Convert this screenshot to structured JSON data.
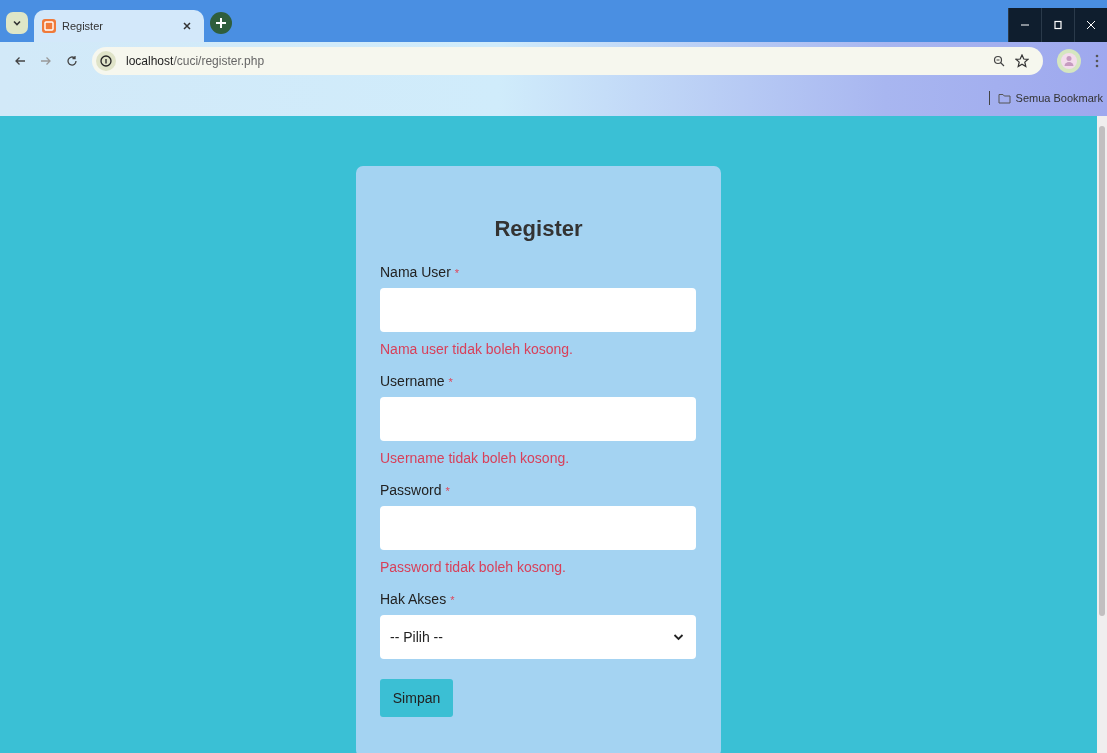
{
  "browser": {
    "tab_title": "Register",
    "url_host": "localhost",
    "url_path": "/cuci/register.php",
    "bookmarks_label": "Semua Bookmark"
  },
  "form": {
    "title": "Register",
    "required_mark": "*",
    "fields": [
      {
        "kind": "text",
        "label": "Nama User",
        "required": true,
        "error": "Nama user tidak boleh kosong."
      },
      {
        "kind": "text",
        "label": "Username",
        "required": true,
        "error": "Username tidak boleh kosong."
      },
      {
        "kind": "password",
        "label": "Password",
        "required": true,
        "error": "Password tidak boleh kosong."
      },
      {
        "kind": "select",
        "label": "Hak Akses",
        "required": true,
        "value": "-- Pilih --"
      }
    ],
    "submit_label": "Simpan"
  }
}
